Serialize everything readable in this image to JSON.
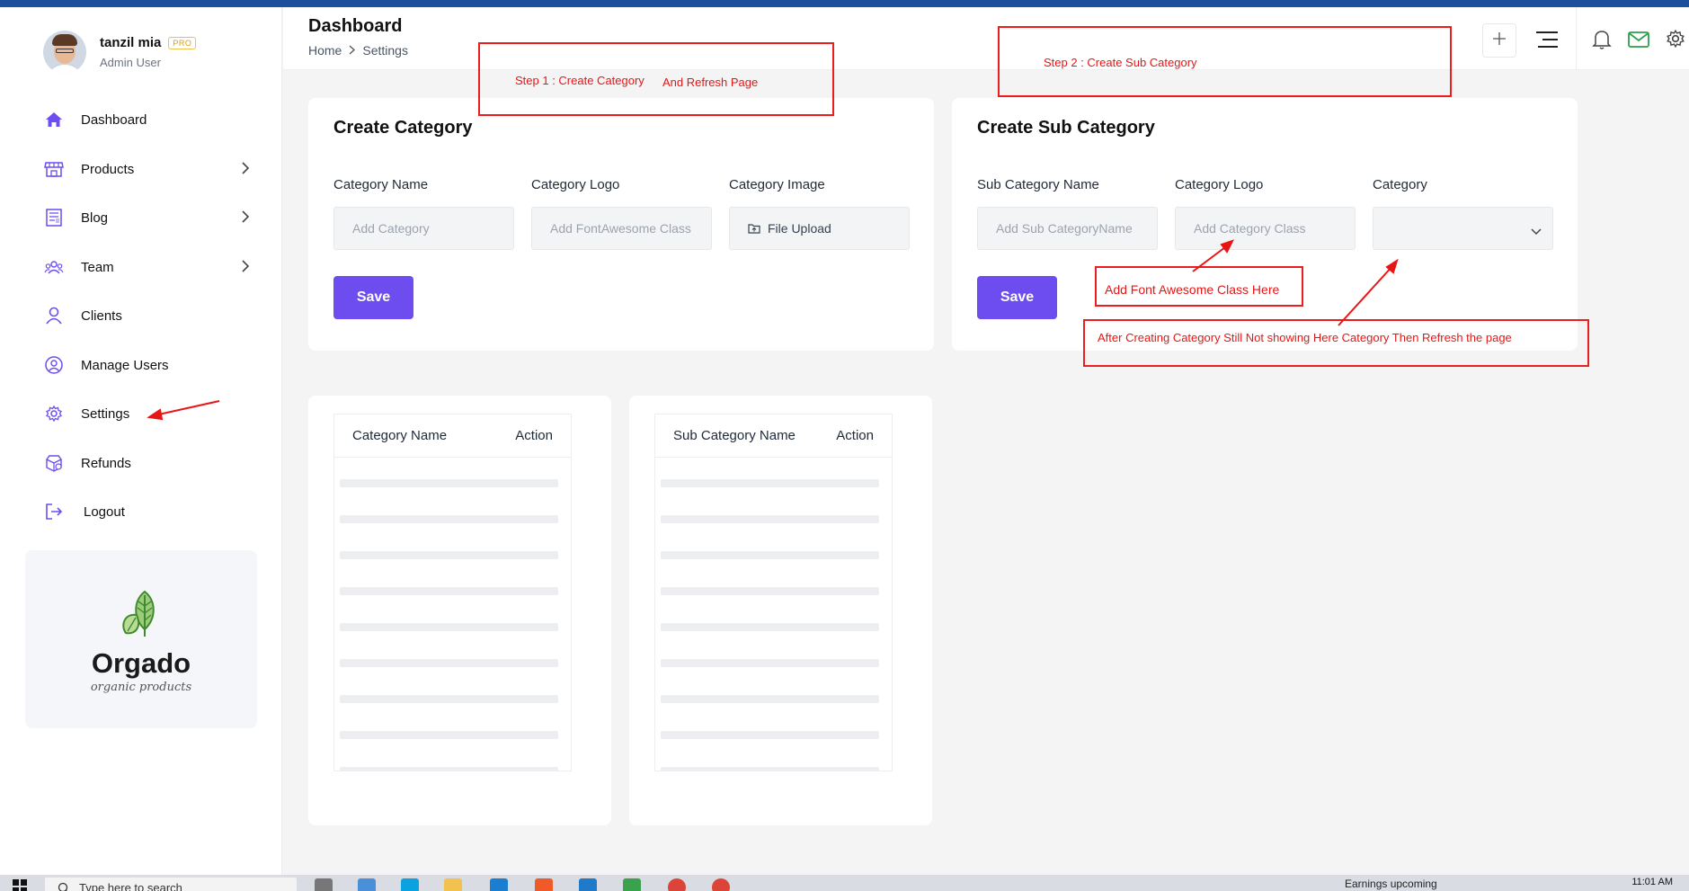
{
  "sidebar": {
    "user": {
      "name": "tanzil mia",
      "badge": "PRO",
      "role": "Admin User"
    },
    "items": [
      {
        "label": "Dashboard",
        "icon": "home-icon",
        "has_submenu": false
      },
      {
        "label": "Products",
        "icon": "store-icon",
        "has_submenu": true
      },
      {
        "label": "Blog",
        "icon": "blog-icon",
        "has_submenu": true
      },
      {
        "label": "Team",
        "icon": "team-icon",
        "has_submenu": true
      },
      {
        "label": "Clients",
        "icon": "user-icon",
        "has_submenu": false
      },
      {
        "label": "Manage Users",
        "icon": "user-circle-icon",
        "has_submenu": false
      },
      {
        "label": "Settings",
        "icon": "gear-icon",
        "has_submenu": false
      },
      {
        "label": "Refunds",
        "icon": "refund-icon",
        "has_submenu": false
      },
      {
        "label": "Logout",
        "icon": "logout-icon",
        "has_submenu": false
      }
    ],
    "brand": {
      "name": "Orgado",
      "tagline": "organic products"
    }
  },
  "header": {
    "title": "Dashboard",
    "breadcrumb": [
      "Home",
      "Settings"
    ],
    "icons": [
      "plus-icon",
      "menu-icon",
      "bell-icon",
      "mail-icon",
      "gear-icon"
    ]
  },
  "create_category": {
    "title": "Create Category",
    "fields": [
      {
        "label": "Category Name",
        "placeholder": "Add Category"
      },
      {
        "label": "Category Logo",
        "placeholder": "Add FontAwesome Class"
      },
      {
        "label": "Category Image",
        "upload_label": "File Upload"
      }
    ],
    "save_label": "Save"
  },
  "create_sub_category": {
    "title": "Create Sub Category",
    "fields": [
      {
        "label": "Sub Category Name",
        "placeholder": "Add Sub CategoryName"
      },
      {
        "label": "Category Logo",
        "placeholder": "Add Category Class"
      },
      {
        "label": "Category",
        "selected": ""
      }
    ],
    "save_label": "Save"
  },
  "category_table": {
    "columns": [
      "Category Name",
      "Action"
    ],
    "rows": []
  },
  "sub_category_table": {
    "columns": [
      "Sub Category Name",
      "Action"
    ],
    "rows": []
  },
  "annotations": {
    "step1_a": "Step 1 : Create Category",
    "step1_b": "And Refresh Page",
    "step2": "Step 2 : Create Sub Category",
    "font_awesome": "Add Font Awesome Class Here",
    "after_creating": "After Creating Category Still Not showing Here Category Then Refresh the page"
  },
  "taskbar": {
    "search_placeholder": "Type here to search",
    "notification": "Earnings upcoming",
    "time": "11:01 AM"
  },
  "colors": {
    "accent": "#6d4cf0",
    "annotation": "#ee1c1c",
    "brand_green": "#5fae4a",
    "top_stripe": "#1e4f9c"
  }
}
